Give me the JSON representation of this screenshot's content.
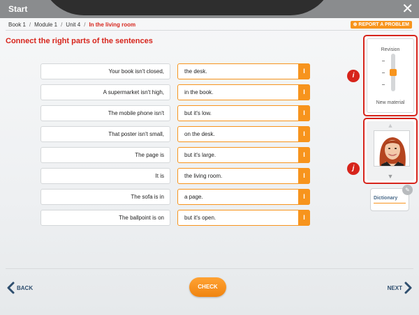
{
  "header": {
    "start_label": "Start",
    "close_symbol": "✕"
  },
  "breadcrumb": [
    {
      "label": "Book 1"
    },
    {
      "label": "Module 1"
    },
    {
      "label": "Unit 4"
    },
    {
      "label": "In the living room"
    }
  ],
  "breadcrumb_separator": "/",
  "report_button": "REPORT A PROBLEM",
  "exercise": {
    "title": "Connect the right parts of the sentences",
    "rows": [
      {
        "left": "Your book isn't closed,",
        "right": "the desk."
      },
      {
        "left": "A supermarket isn't high,",
        "right": "in the book."
      },
      {
        "left": "The mobile phone isn't",
        "right": "but it's low."
      },
      {
        "left": "That poster isn't small,",
        "right": "on the desk."
      },
      {
        "left": "The page is",
        "right": "but it's large."
      },
      {
        "left": "It is",
        "right": "the living room."
      },
      {
        "left": "The sofa is in",
        "right": "a page."
      },
      {
        "left": "The ballpoint is on",
        "right": "but it's open."
      }
    ],
    "handle_symbol": "I"
  },
  "side": {
    "revision_label": "Revision",
    "new_material_label": "New material",
    "slider_level": 0.5,
    "badge_i": "i",
    "badge_j": "j",
    "dictionary_label": "Dictionary"
  },
  "footer": {
    "back_label": "BACK",
    "check_label": "CHECK",
    "next_label": "NEXT"
  },
  "colors": {
    "accent": "#f7941d",
    "red": "#d7241b",
    "nav": "#2f4f6f"
  },
  "icons": [
    "close-icon",
    "report-icon",
    "drag-handle-icon",
    "chevron-up-icon",
    "chevron-down-icon",
    "pencil-icon",
    "chevron-left-icon",
    "chevron-right-icon"
  ]
}
